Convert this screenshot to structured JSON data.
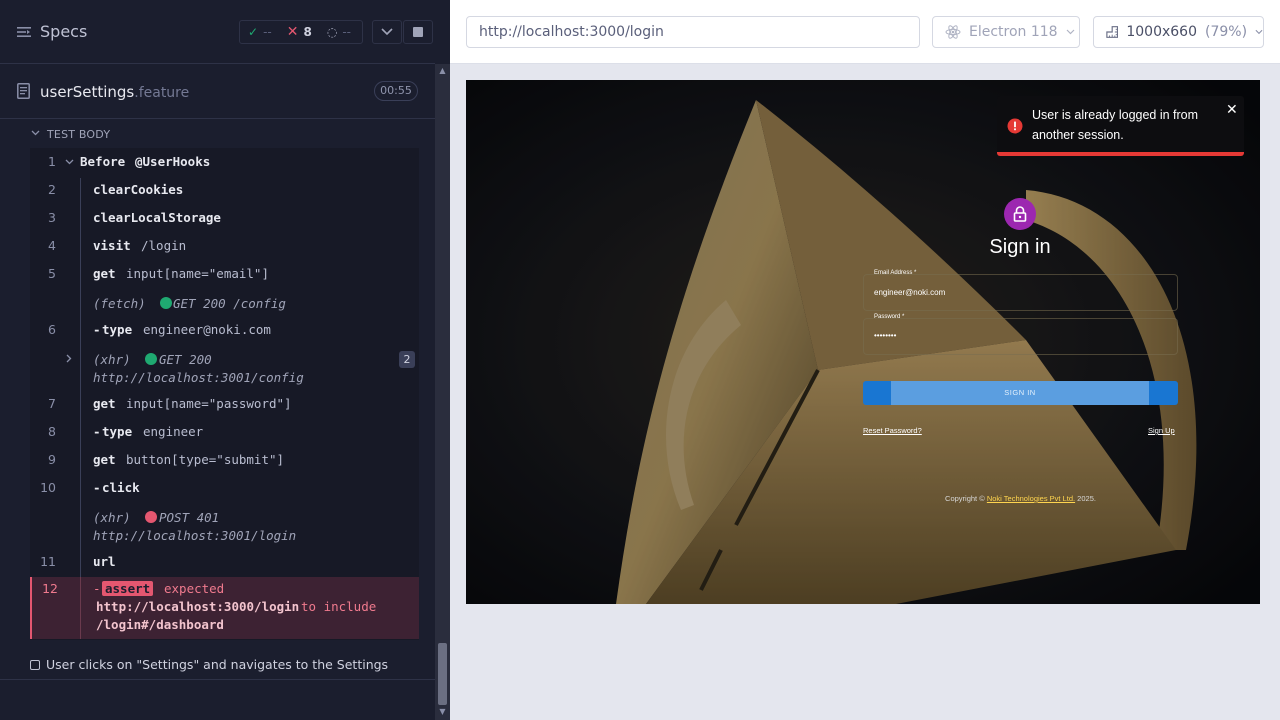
{
  "runner": {
    "title": "Specs",
    "stats": {
      "passed": "--",
      "failed": "8",
      "pending": "--"
    },
    "spec": {
      "name": "userSettings",
      "ext": ".feature",
      "duration": "00:55"
    },
    "section_label": "TEST BODY",
    "commands": [
      {
        "num": "1",
        "name": "Before",
        "arg": "@UserHooks"
      },
      {
        "num": "2",
        "name": "clearCookies",
        "arg": ""
      },
      {
        "num": "3",
        "name": "clearLocalStorage",
        "arg": ""
      },
      {
        "num": "4",
        "name": "visit",
        "arg": "/login"
      },
      {
        "num": "5",
        "name": "get",
        "arg": "input[name=\"email\"]"
      },
      {
        "num": "",
        "xhr": "(fetch)",
        "text": "GET 200 /config"
      },
      {
        "num": "6",
        "name": "type",
        "arg": "engineer@noki.com"
      },
      {
        "num": "",
        "xhr": "(xhr)",
        "text": "GET 200",
        "url": "http://localhost:3001/config",
        "badge": "2"
      },
      {
        "num": "7",
        "name": "get",
        "arg": "input[name=\"password\"]"
      },
      {
        "num": "8",
        "name": "type",
        "arg": "engineer"
      },
      {
        "num": "9",
        "name": "get",
        "arg": "button[type=\"submit\"]"
      },
      {
        "num": "10",
        "name": "click",
        "arg": ""
      },
      {
        "num": "",
        "xhr": "(xhr)",
        "text": "POST 401",
        "url": "http://localhost:3001/login"
      },
      {
        "num": "11",
        "name": "url",
        "arg": ""
      }
    ],
    "error": {
      "num": "12",
      "tag": "assert",
      "word1": "expected",
      "actual": "http://localhost:3000/login",
      "word2": "to include",
      "expected": "/login#/dashboard"
    },
    "next_test": "User clicks on \"Settings\" and navigates to the Settings"
  },
  "aut": {
    "url": "http://localhost:3000/login",
    "browser": "Electron 118",
    "viewport": "1000x660",
    "zoom": "(79%)"
  },
  "app": {
    "toast": "User is already logged in from another session.",
    "title": "Sign in",
    "email_label": "Email Address *",
    "email_value": "engineer@noki.com",
    "password_label": "Password *",
    "password_value": "••••••••",
    "button": "SIGN IN",
    "reset_link": "Reset Password?",
    "signup_link": "Sign Up",
    "copyright_prefix": "Copyright © ",
    "copyright_company": "Noki Technologies Pvt Ltd.",
    "copyright_year": " 2025."
  },
  "colors": {
    "accent": "#1fa971",
    "error": "#e45770",
    "primary_button": "#1976d2",
    "lock": "#9c27b0",
    "toast_bar": "#e53935"
  }
}
